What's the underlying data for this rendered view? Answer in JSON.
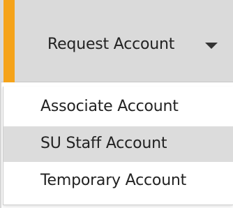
{
  "dropdown": {
    "label": "Request Account",
    "caret_icon": "caret-down-icon",
    "accent_color": "#f5a31a",
    "button_color": "#dadada"
  },
  "menu": {
    "items": [
      {
        "label": "Associate Account",
        "highlighted": false
      },
      {
        "label": "SU Staff Account",
        "highlighted": true
      },
      {
        "label": "Temporary Account",
        "highlighted": false
      }
    ],
    "highlight_color": "#dcdcdc"
  }
}
